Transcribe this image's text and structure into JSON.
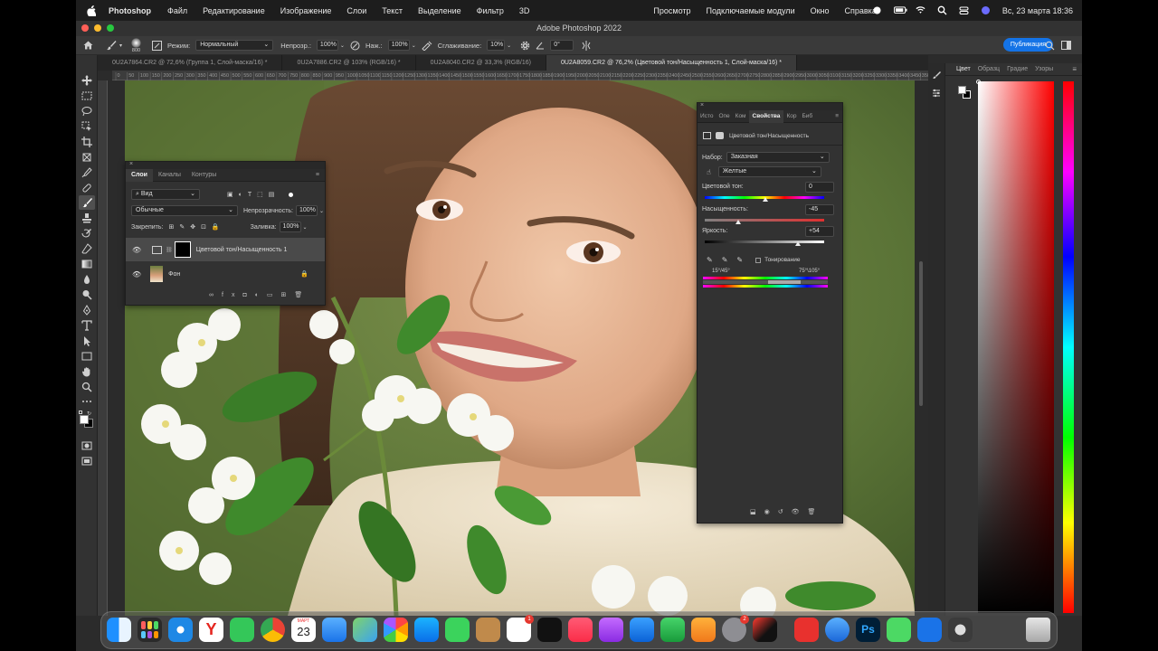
{
  "menubar": {
    "app_name": "Photoshop",
    "items": [
      "Файл",
      "Редактирование",
      "Изображение",
      "Слои",
      "Текст",
      "Выделение",
      "Фильтр",
      "3D",
      "Просмотр",
      "Подключаемые модули",
      "Окно",
      "Справка"
    ],
    "datetime": "Вс, 23 марта  18:36"
  },
  "window": {
    "title": "Adobe Photoshop 2022"
  },
  "options_bar": {
    "brush_size": "800",
    "mode_label": "Режим:",
    "mode_value": "Нормальный",
    "opacity_label": "Непрозр.:",
    "opacity_value": "100%",
    "flow_label": "Наж.:",
    "flow_value": "100%",
    "smoothing_label": "Сглаживание:",
    "smoothing_value": "10%",
    "angle_value": "0°",
    "publish_label": "Публикация"
  },
  "tabs": [
    "0U2A7864.CR2 @ 72,6% (Группа 1, Слой-маска/16) *",
    "0U2A7886.CR2 @ 103% (RGB/16) *",
    "0U2A8040.CR2 @ 33,3% (RGB/16)",
    "0U2A8059.CR2 @ 76,2% (Цветовой тон/Насыщенность 1, Слой-маска/16) *"
  ],
  "ruler": {
    "marks": [
      "0",
      "50",
      "100",
      "150",
      "200",
      "250",
      "300",
      "350",
      "400",
      "450",
      "500",
      "550",
      "600",
      "650",
      "700",
      "750",
      "800",
      "850",
      "900",
      "950",
      "1000",
      "1050",
      "1100",
      "1150",
      "1200",
      "1250",
      "1300",
      "1350",
      "1400",
      "1450",
      "1500",
      "1550",
      "1600",
      "1650",
      "1700",
      "1750",
      "1800",
      "1850",
      "1900",
      "1950",
      "2000",
      "2050",
      "2100",
      "2150",
      "2200",
      "2250",
      "2300",
      "2350",
      "2400",
      "2450",
      "2500",
      "2550",
      "2600",
      "2650",
      "2700",
      "2750",
      "2800",
      "2850",
      "2900",
      "2950",
      "3000",
      "3050",
      "3100",
      "3150",
      "3200",
      "3250",
      "3300",
      "3350",
      "3400",
      "3450",
      "3500"
    ]
  },
  "layers_panel": {
    "tabs": [
      "Слои",
      "Каналы",
      "Контуры"
    ],
    "filter_label": "Вид",
    "blend_mode": "Обычные",
    "opacity_label": "Непрозрачность:",
    "opacity_value": "100%",
    "lock_label": "Закрепить:",
    "fill_label": "Заливка:",
    "fill_value": "100%",
    "layers": [
      {
        "name": "Цветовой тон/Насыщенность 1"
      },
      {
        "name": "Фон"
      }
    ]
  },
  "properties_panel": {
    "tabs": [
      "Исто",
      "Опе",
      "Ком",
      "Свойства",
      "Кор",
      "Биб"
    ],
    "title": "Цветовой тон/Насыщенность",
    "preset_label": "Набор:",
    "preset_value": "Заказная",
    "channel_value": "Желтые",
    "hue_label": "Цветовой тон:",
    "hue_value": "0",
    "saturation_label": "Насыщенность:",
    "saturation_value": "-45",
    "lightness_label": "Яркость:",
    "lightness_value": "+54",
    "colorize_label": "Тонирование",
    "range_left": "15°/45°",
    "range_right": "75°\\105°"
  },
  "color_panel": {
    "tabs": [
      "Цвет",
      "Образц",
      "Градие",
      "Узоры"
    ],
    "hue_pointer": 0.0
  },
  "dock": {
    "calendar_month": "МАРТ",
    "calendar_day": "23",
    "reminders_badge": "1",
    "settings_badge": "2",
    "photoshop_label": "Ps"
  }
}
